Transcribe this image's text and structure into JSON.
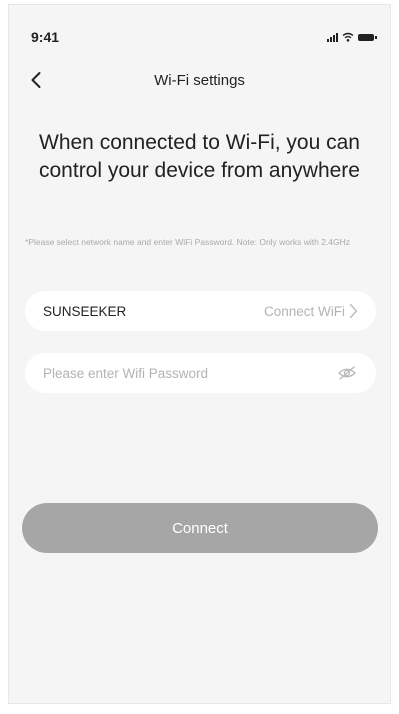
{
  "status_bar": {
    "time": "9:41",
    "signal_icon": "signal-icon",
    "wifi_icon": "wifi-icon",
    "battery_icon": "battery-icon"
  },
  "nav": {
    "back_icon": "chevron-left-icon",
    "title": "Wi-Fi settings"
  },
  "headline": "When connected to Wi-Fi, you can control your device from anywhere",
  "note": "*Please select network name and enter WiFi Password. Note: Only works with 2.4GHz",
  "network": {
    "name": "SUNSEEKER",
    "action_label": "Connect WiFi",
    "action_icon": "chevron-right-icon"
  },
  "password": {
    "value": "",
    "placeholder": "Please enter Wifi Password",
    "toggle_icon": "eye-off-icon"
  },
  "connect_button": {
    "label": "Connect",
    "color": "#a6a6a6"
  },
  "colors": {
    "background": "#f5f5f5",
    "card": "#ffffff",
    "muted_text": "#b3b3b3"
  }
}
